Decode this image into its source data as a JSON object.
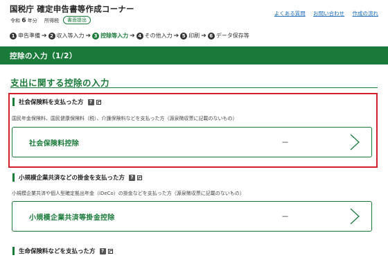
{
  "header": {
    "title": "国税庁 確定申告書等作成コーナー",
    "tax_year_prefix": "令和",
    "tax_year_number": "6",
    "tax_year_suffix": "年分",
    "office": "所得税",
    "screen_button": "書面提出",
    "links": [
      "よくある質問",
      "お問い合わせ",
      "作成の流れ"
    ]
  },
  "steps": [
    {
      "num": "1",
      "label": "申告準備"
    },
    {
      "num": "2",
      "label": "収入等入力"
    },
    {
      "num": "3",
      "label": "控除等入力",
      "current": true
    },
    {
      "num": "4",
      "label": "その他入力"
    },
    {
      "num": "5",
      "label": "印刷"
    },
    {
      "num": "6",
      "label": "データ保存等"
    }
  ],
  "page_heading": "控除の入力（1/2）",
  "section_title": "支出に関する控除の入力",
  "categories": [
    {
      "heading": "社会保険料を支払った方",
      "description": "国民年金保険料、国民健康保険料（税）、介護保険料などを支払った方（源泉徴収票に記載のないもの）",
      "card_label": "社会保険料控除",
      "card_value": "－"
    },
    {
      "heading": "小規模企業共済などの掛金を支払った方",
      "description": "小規模企業共済や個人型確定拠出年金（iDeCo）の掛金などを支払った方（源泉徴収票に記載のないもの）",
      "card_label": "小規模企業共済等掛金控除",
      "card_value": "－"
    },
    {
      "heading": "生命保険料などを支払った方"
    }
  ],
  "icons": {
    "help": "?",
    "help_icon": "help-icon",
    "copy_icon": "copy-icon",
    "chevron_icon": "chevron-right-icon"
  },
  "colors": {
    "brand_green": "#1a7a3a",
    "highlight_red": "#d21e28",
    "link_blue": "#1a6ab8"
  }
}
